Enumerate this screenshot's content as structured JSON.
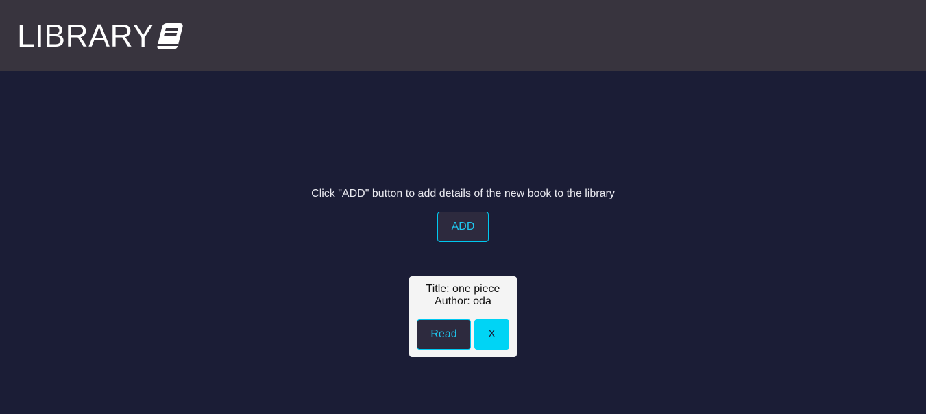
{
  "header": {
    "title": "LIBRARY",
    "icon": "book-icon",
    "background": "#38343e"
  },
  "main": {
    "background": "#1b1d36",
    "instruction": "Click \"ADD\" button to add details of the new book to the library",
    "add_label": "ADD",
    "accent": "#00c8f0"
  },
  "books": [
    {
      "title_line": "Title: one piece",
      "author_line": "Author: oda",
      "read_label": "Read",
      "remove_label": "X"
    }
  ]
}
